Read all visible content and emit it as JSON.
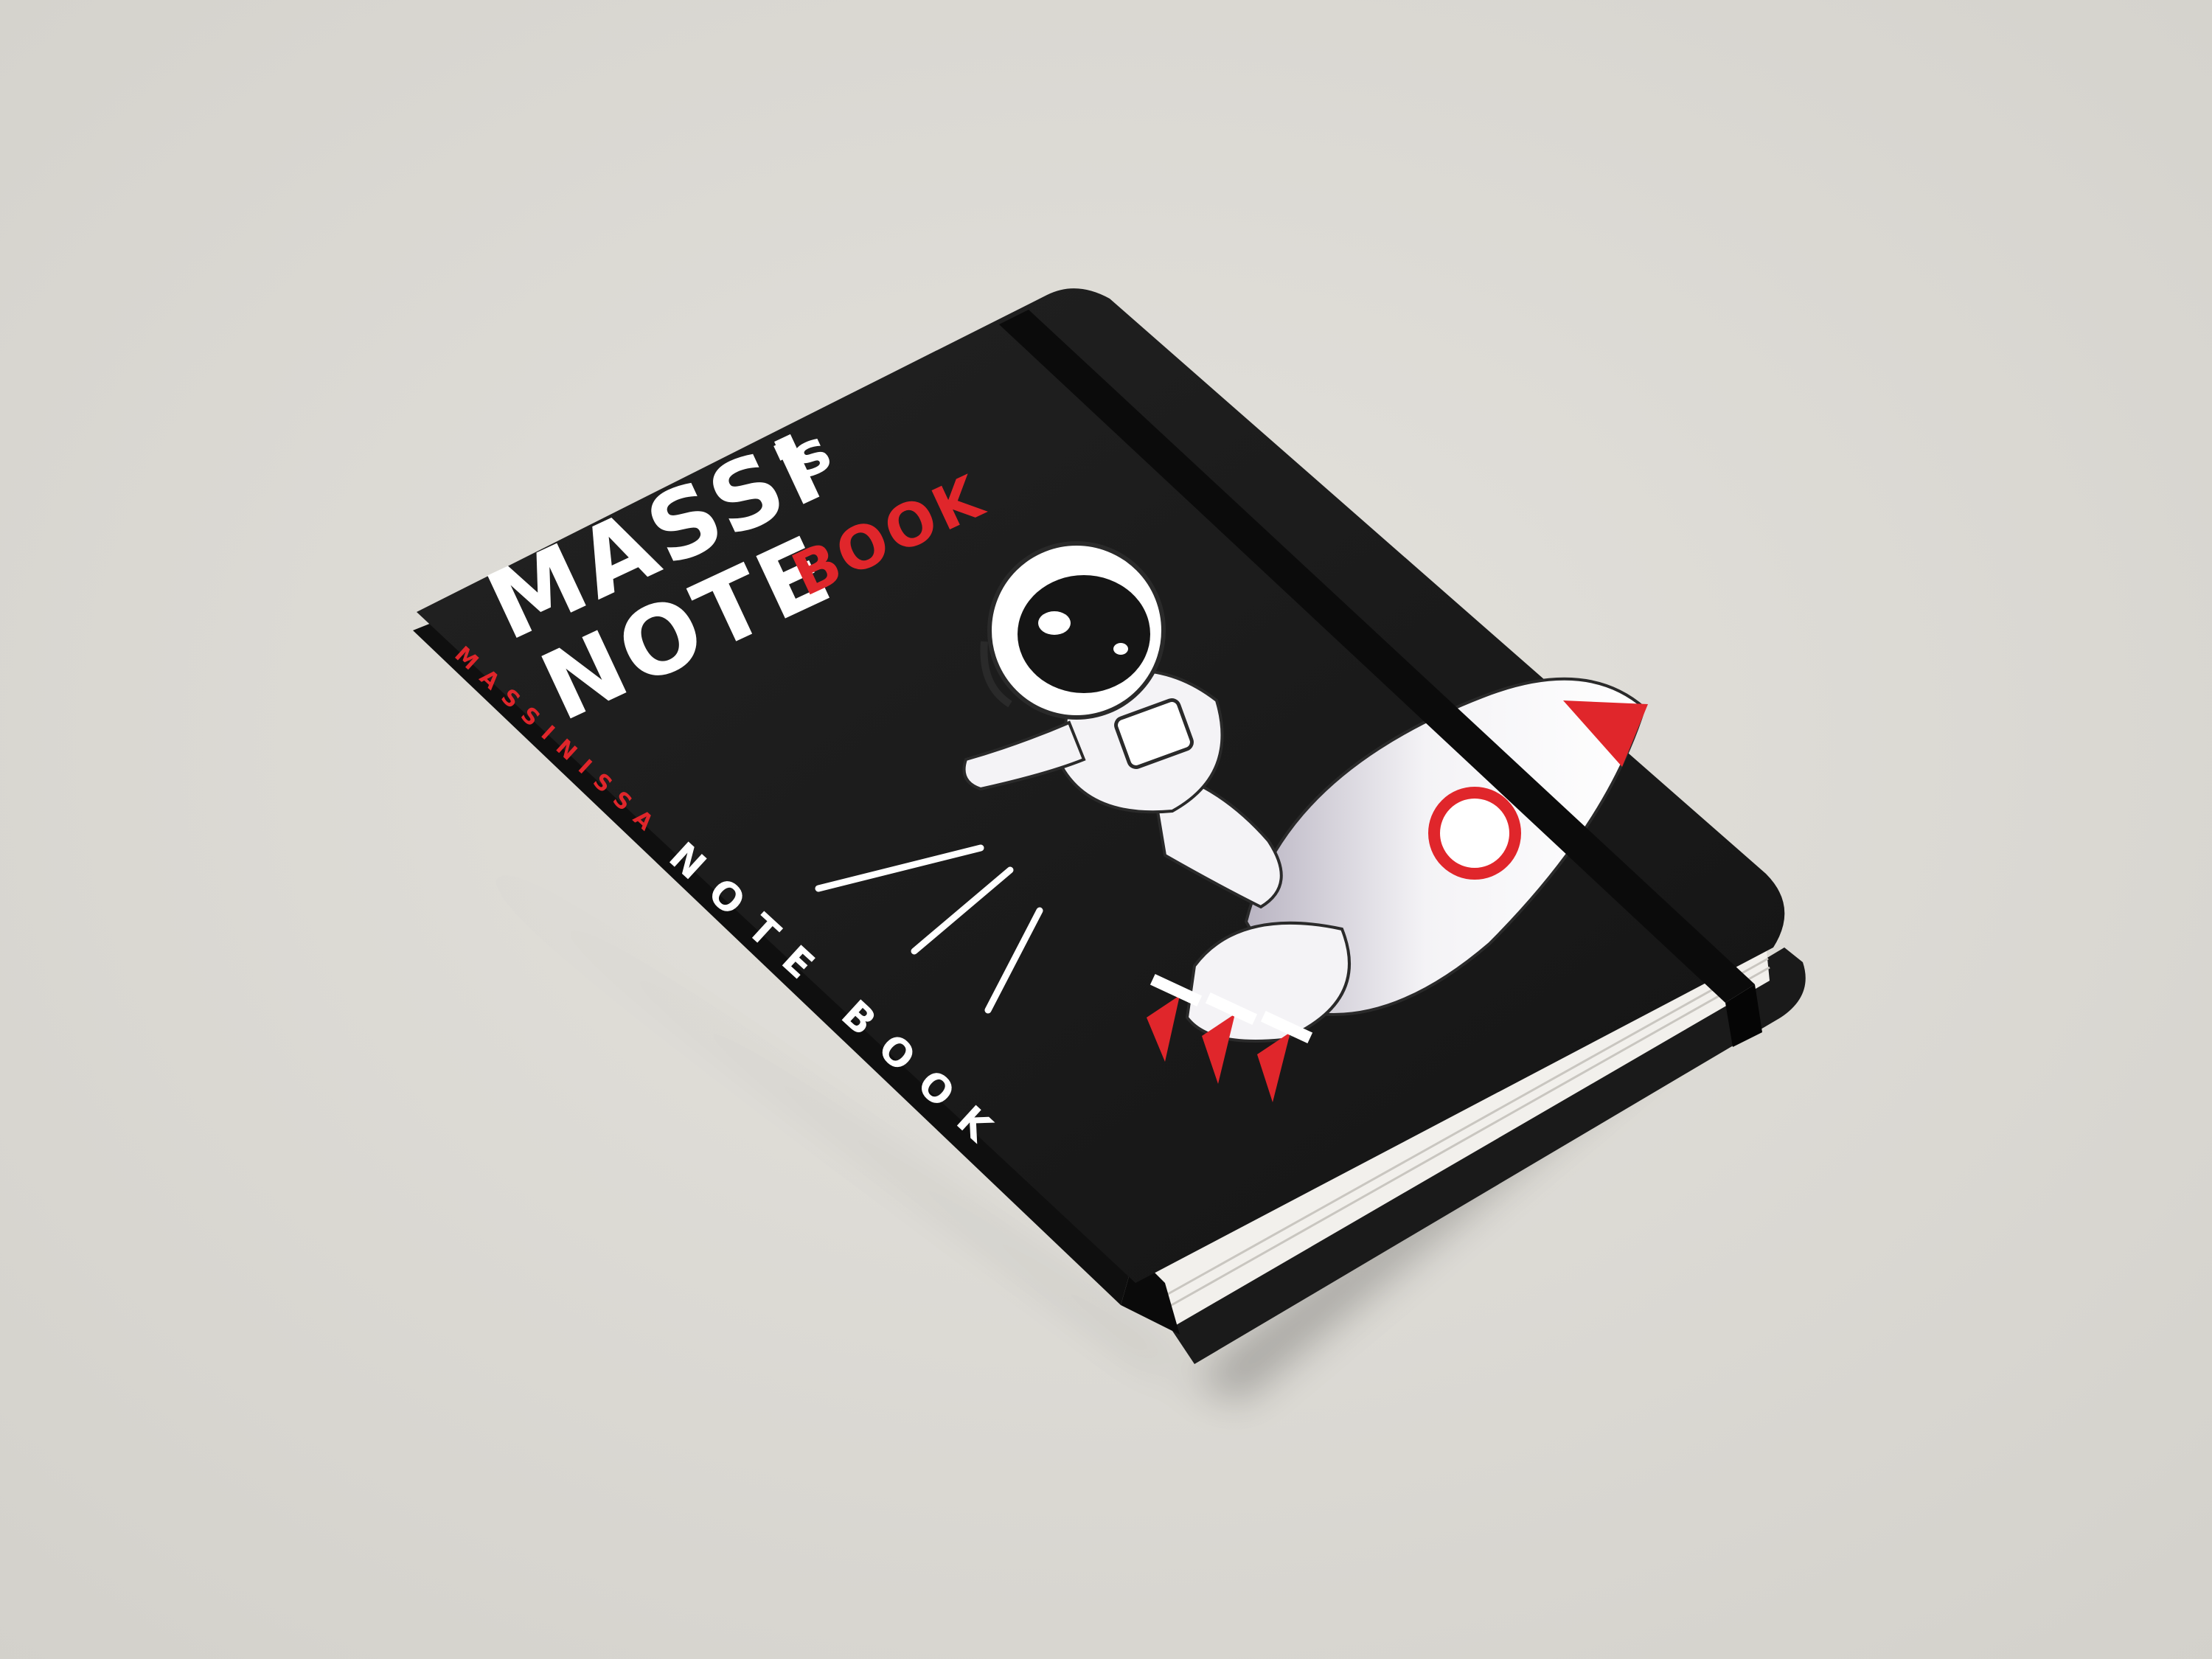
{
  "scene": {
    "background_color": "#dedcd7",
    "subject": "notebook-mockup"
  },
  "cover": {
    "title_line1": "MASSI",
    "title_possessive": "'s",
    "title_line2a": "NOTE",
    "title_line2b": "BOOK",
    "cover_color": "#1b1b1b",
    "title_color": "#ffffff",
    "accent_color": "#e0262b"
  },
  "spine": {
    "author": "MASSINISSA",
    "title": "NOTE BOOK"
  },
  "illustration": {
    "character": "astronaut",
    "vehicle": "rocket"
  }
}
